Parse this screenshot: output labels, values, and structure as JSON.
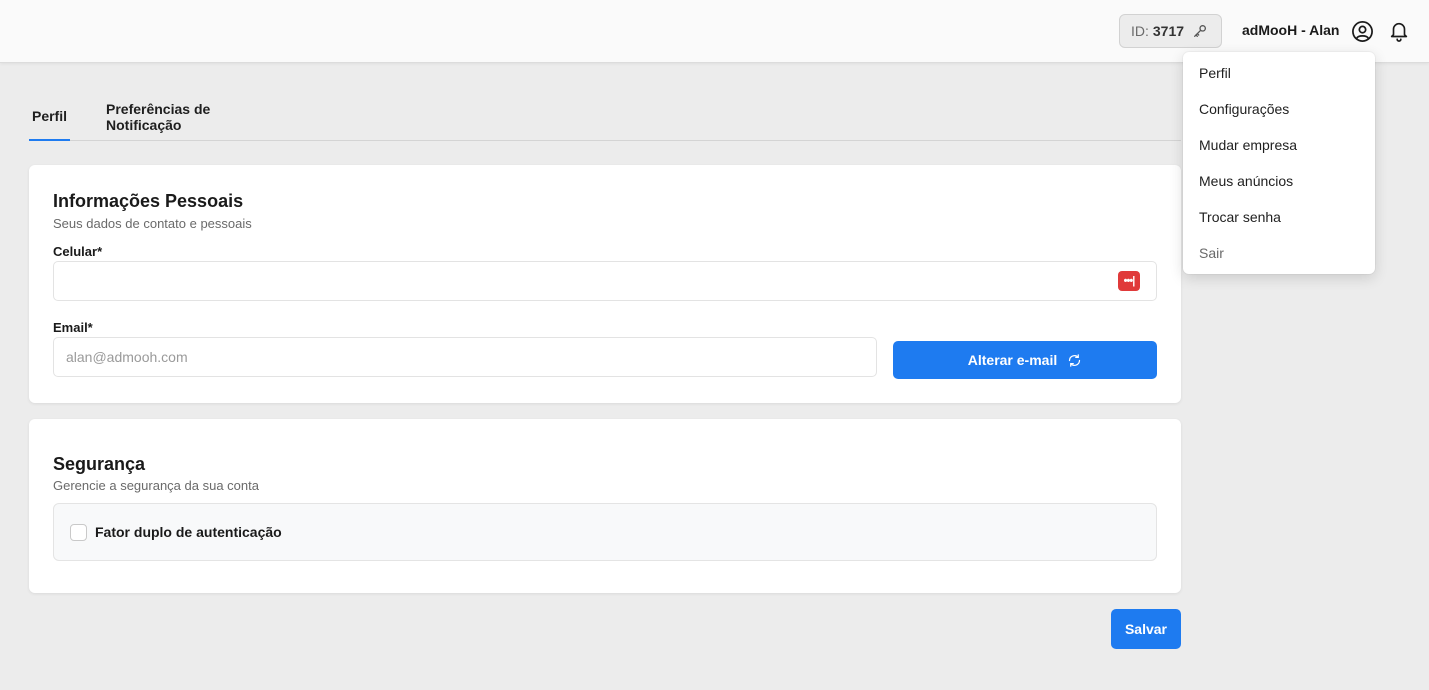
{
  "header": {
    "id_label": "ID:",
    "id_value": "3717",
    "user_name": "adMooH - Alan"
  },
  "tabs": [
    {
      "label": "Perfil",
      "active": true
    },
    {
      "label": "Preferências de Notificação",
      "active": false
    }
  ],
  "personal": {
    "title": "Informações Pessoais",
    "subtitle": "Seus dados de contato e pessoais",
    "phone_label": "Celular*",
    "phone_value": "",
    "email_label": "Email*",
    "email_placeholder": "alan@admooh.com",
    "change_email_label": "Alterar e-mail",
    "password_badge": "•••|"
  },
  "security": {
    "title": "Segurança",
    "subtitle": "Gerencie a segurança da sua conta",
    "twofa_label": "Fator duplo de autenticação",
    "twofa_checked": false
  },
  "save_label": "Salvar",
  "user_menu": [
    "Perfil",
    "Configurações",
    "Mudar empresa",
    "Meus anúncios",
    "Trocar senha",
    "Sair"
  ],
  "colors": {
    "accent": "#1e7bf0",
    "background": "#ececec",
    "card": "#ffffff",
    "password_badge": "#e03a3a"
  },
  "icons": [
    "key-icon",
    "user-circle-icon",
    "bell-icon",
    "refresh-icon"
  ]
}
